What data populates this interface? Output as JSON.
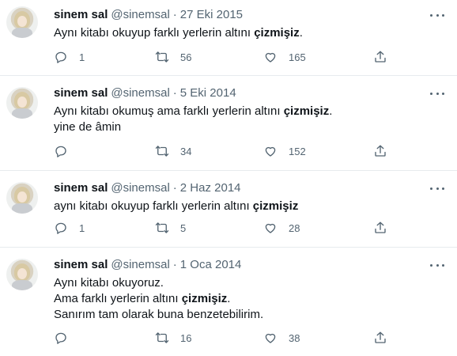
{
  "tweets": [
    {
      "name": "sinem sal",
      "handle": "@sinemsal",
      "separator": "·",
      "date": "27 Eki 2015",
      "lines": [
        {
          "pre": "Aynı kitabı okuyup farklı yerlerin altını ",
          "bold": "çizmişiz",
          "post": "."
        }
      ],
      "replies": "1",
      "retweets": "56",
      "likes": "165"
    },
    {
      "name": "sinem sal",
      "handle": "@sinemsal",
      "separator": "·",
      "date": "5 Eki 2014",
      "lines": [
        {
          "pre": "Aynı kitabı okumuş ama farklı yerlerin altını ",
          "bold": "çizmişiz",
          "post": "."
        },
        {
          "pre": "yine de âmin",
          "bold": "",
          "post": ""
        }
      ],
      "replies": "",
      "retweets": "34",
      "likes": "152"
    },
    {
      "name": "sinem sal",
      "handle": "@sinemsal",
      "separator": "·",
      "date": "2 Haz 2014",
      "lines": [
        {
          "pre": "aynı kitabı okuyup farklı yerlerin altını ",
          "bold": "çizmişiz",
          "post": ""
        }
      ],
      "replies": "1",
      "retweets": "5",
      "likes": "28"
    },
    {
      "name": "sinem sal",
      "handle": "@sinemsal",
      "separator": "·",
      "date": "1 Oca 2014",
      "lines": [
        {
          "pre": "Aynı kitabı okuyoruz.",
          "bold": "",
          "post": ""
        },
        {
          "pre": "Ama farklı yerlerin altını ",
          "bold": "çizmişiz",
          "post": "."
        },
        {
          "pre": "Sanırım tam olarak buna benzetebilirim.",
          "bold": "",
          "post": ""
        }
      ],
      "replies": "",
      "retweets": "16",
      "likes": "38"
    }
  ],
  "icons": {
    "reply": "reply-icon",
    "retweet": "retweet-icon",
    "like": "like-icon",
    "share": "share-icon",
    "more": "more-icon"
  },
  "colors": {
    "text": "#0f1419",
    "secondary": "#536471",
    "divider": "#e7ebee"
  }
}
